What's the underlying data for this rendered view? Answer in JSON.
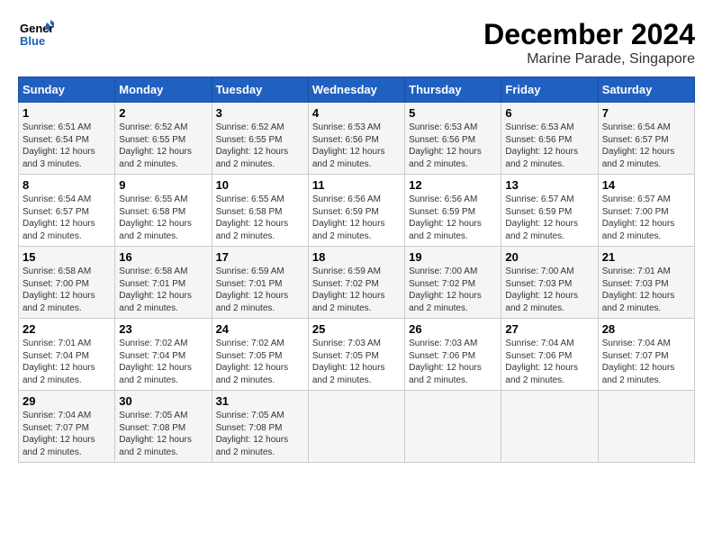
{
  "logo": {
    "line1": "General",
    "line2": "Blue"
  },
  "title": "December 2024",
  "subtitle": "Marine Parade, Singapore",
  "days_of_week": [
    "Sunday",
    "Monday",
    "Tuesday",
    "Wednesday",
    "Thursday",
    "Friday",
    "Saturday"
  ],
  "weeks": [
    [
      {
        "day": "1",
        "info": "Sunrise: 6:51 AM\nSunset: 6:54 PM\nDaylight: 12 hours\nand 3 minutes."
      },
      {
        "day": "2",
        "info": "Sunrise: 6:52 AM\nSunset: 6:55 PM\nDaylight: 12 hours\nand 2 minutes."
      },
      {
        "day": "3",
        "info": "Sunrise: 6:52 AM\nSunset: 6:55 PM\nDaylight: 12 hours\nand 2 minutes."
      },
      {
        "day": "4",
        "info": "Sunrise: 6:53 AM\nSunset: 6:56 PM\nDaylight: 12 hours\nand 2 minutes."
      },
      {
        "day": "5",
        "info": "Sunrise: 6:53 AM\nSunset: 6:56 PM\nDaylight: 12 hours\nand 2 minutes."
      },
      {
        "day": "6",
        "info": "Sunrise: 6:53 AM\nSunset: 6:56 PM\nDaylight: 12 hours\nand 2 minutes."
      },
      {
        "day": "7",
        "info": "Sunrise: 6:54 AM\nSunset: 6:57 PM\nDaylight: 12 hours\nand 2 minutes."
      }
    ],
    [
      {
        "day": "8",
        "info": "Sunrise: 6:54 AM\nSunset: 6:57 PM\nDaylight: 12 hours\nand 2 minutes."
      },
      {
        "day": "9",
        "info": "Sunrise: 6:55 AM\nSunset: 6:58 PM\nDaylight: 12 hours\nand 2 minutes."
      },
      {
        "day": "10",
        "info": "Sunrise: 6:55 AM\nSunset: 6:58 PM\nDaylight: 12 hours\nand 2 minutes."
      },
      {
        "day": "11",
        "info": "Sunrise: 6:56 AM\nSunset: 6:59 PM\nDaylight: 12 hours\nand 2 minutes."
      },
      {
        "day": "12",
        "info": "Sunrise: 6:56 AM\nSunset: 6:59 PM\nDaylight: 12 hours\nand 2 minutes."
      },
      {
        "day": "13",
        "info": "Sunrise: 6:57 AM\nSunset: 6:59 PM\nDaylight: 12 hours\nand 2 minutes."
      },
      {
        "day": "14",
        "info": "Sunrise: 6:57 AM\nSunset: 7:00 PM\nDaylight: 12 hours\nand 2 minutes."
      }
    ],
    [
      {
        "day": "15",
        "info": "Sunrise: 6:58 AM\nSunset: 7:00 PM\nDaylight: 12 hours\nand 2 minutes."
      },
      {
        "day": "16",
        "info": "Sunrise: 6:58 AM\nSunset: 7:01 PM\nDaylight: 12 hours\nand 2 minutes."
      },
      {
        "day": "17",
        "info": "Sunrise: 6:59 AM\nSunset: 7:01 PM\nDaylight: 12 hours\nand 2 minutes."
      },
      {
        "day": "18",
        "info": "Sunrise: 6:59 AM\nSunset: 7:02 PM\nDaylight: 12 hours\nand 2 minutes."
      },
      {
        "day": "19",
        "info": "Sunrise: 7:00 AM\nSunset: 7:02 PM\nDaylight: 12 hours\nand 2 minutes."
      },
      {
        "day": "20",
        "info": "Sunrise: 7:00 AM\nSunset: 7:03 PM\nDaylight: 12 hours\nand 2 minutes."
      },
      {
        "day": "21",
        "info": "Sunrise: 7:01 AM\nSunset: 7:03 PM\nDaylight: 12 hours\nand 2 minutes."
      }
    ],
    [
      {
        "day": "22",
        "info": "Sunrise: 7:01 AM\nSunset: 7:04 PM\nDaylight: 12 hours\nand 2 minutes."
      },
      {
        "day": "23",
        "info": "Sunrise: 7:02 AM\nSunset: 7:04 PM\nDaylight: 12 hours\nand 2 minutes."
      },
      {
        "day": "24",
        "info": "Sunrise: 7:02 AM\nSunset: 7:05 PM\nDaylight: 12 hours\nand 2 minutes."
      },
      {
        "day": "25",
        "info": "Sunrise: 7:03 AM\nSunset: 7:05 PM\nDaylight: 12 hours\nand 2 minutes."
      },
      {
        "day": "26",
        "info": "Sunrise: 7:03 AM\nSunset: 7:06 PM\nDaylight: 12 hours\nand 2 minutes."
      },
      {
        "day": "27",
        "info": "Sunrise: 7:04 AM\nSunset: 7:06 PM\nDaylight: 12 hours\nand 2 minutes."
      },
      {
        "day": "28",
        "info": "Sunrise: 7:04 AM\nSunset: 7:07 PM\nDaylight: 12 hours\nand 2 minutes."
      }
    ],
    [
      {
        "day": "29",
        "info": "Sunrise: 7:04 AM\nSunset: 7:07 PM\nDaylight: 12 hours\nand 2 minutes."
      },
      {
        "day": "30",
        "info": "Sunrise: 7:05 AM\nSunset: 7:08 PM\nDaylight: 12 hours\nand 2 minutes."
      },
      {
        "day": "31",
        "info": "Sunrise: 7:05 AM\nSunset: 7:08 PM\nDaylight: 12 hours\nand 2 minutes."
      },
      {
        "day": "",
        "info": ""
      },
      {
        "day": "",
        "info": ""
      },
      {
        "day": "",
        "info": ""
      },
      {
        "day": "",
        "info": ""
      }
    ]
  ]
}
